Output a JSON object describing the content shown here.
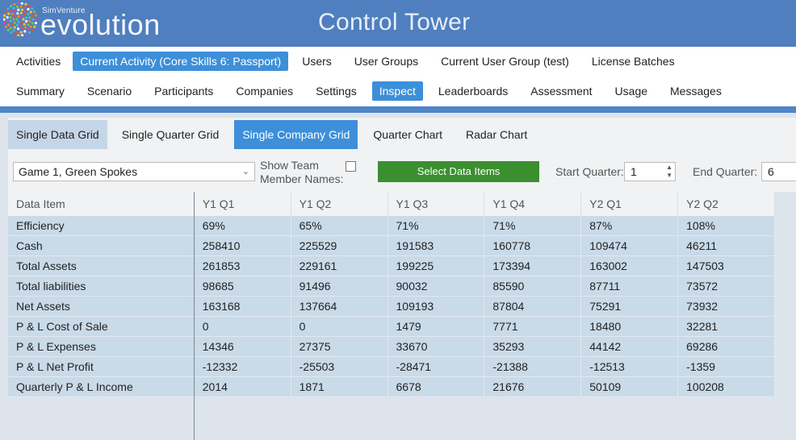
{
  "brand": {
    "small": "SimVenture",
    "big": "evolution",
    "logo_icon": "dotted-globe-icon"
  },
  "app_title": "Control Tower",
  "nav_top": [
    {
      "label": "Activities"
    },
    {
      "label": "Current Activity (Core Skills 6: Passport)",
      "active": true
    },
    {
      "label": "Users"
    },
    {
      "label": "User Groups"
    },
    {
      "label": "Current User Group (test)"
    },
    {
      "label": "License Batches"
    }
  ],
  "nav_second": [
    {
      "label": "Summary"
    },
    {
      "label": "Scenario"
    },
    {
      "label": "Participants"
    },
    {
      "label": "Companies"
    },
    {
      "label": "Settings"
    },
    {
      "label": "Inspect",
      "active": true
    },
    {
      "label": "Leaderboards"
    },
    {
      "label": "Assessment"
    },
    {
      "label": "Usage"
    },
    {
      "label": "Messages"
    }
  ],
  "subtabs": [
    {
      "label": "Single Data Grid"
    },
    {
      "label": "Single Quarter Grid"
    },
    {
      "label": "Single Company Grid",
      "active": true
    },
    {
      "label": "Quarter Chart"
    },
    {
      "label": "Radar Chart"
    }
  ],
  "controls": {
    "company_value": "Game 1,  Green Spokes",
    "show_team_label_1": "Show Team",
    "show_team_label_2": "Member Names:",
    "select_button": "Select Data Items",
    "start_label": "Start Quarter:",
    "start_value": "1",
    "end_label": "End Quarter:",
    "end_value": "6"
  },
  "grid": {
    "columns": [
      "Data Item",
      "Y1 Q1",
      "Y1 Q2",
      "Y1 Q3",
      "Y1 Q4",
      "Y2 Q1",
      "Y2 Q2"
    ],
    "rows": [
      [
        "Efficiency",
        "69%",
        "65%",
        "71%",
        "71%",
        "87%",
        "108%"
      ],
      [
        "Cash",
        "258410",
        "225529",
        "191583",
        "160778",
        "109474",
        "46211"
      ],
      [
        "Total Assets",
        "261853",
        "229161",
        "199225",
        "173394",
        "163002",
        "147503"
      ],
      [
        "Total liabilities",
        "98685",
        "91496",
        "90032",
        "85590",
        "87711",
        "73572"
      ],
      [
        "Net Assets",
        "163168",
        "137664",
        "109193",
        "87804",
        "75291",
        "73932"
      ],
      [
        "P & L Cost of Sale",
        "0",
        "0",
        "1479",
        "7771",
        "18480",
        "32281"
      ],
      [
        "P & L Expenses",
        "14346",
        "27375",
        "33670",
        "35293",
        "44142",
        "69286"
      ],
      [
        "P & L Net Profit",
        "-12332",
        "-25503",
        "-28471",
        "-21388",
        "-12513",
        "-1359"
      ],
      [
        "Quarterly P & L Income",
        "2014",
        "1871",
        "6678",
        "21676",
        "50109",
        "100208"
      ]
    ]
  },
  "colors": {
    "header_blue": "#4f7fbe",
    "active_blue": "#3d8fd9",
    "green_button": "#3a8f2e",
    "row_blue": "#c9dae8"
  }
}
